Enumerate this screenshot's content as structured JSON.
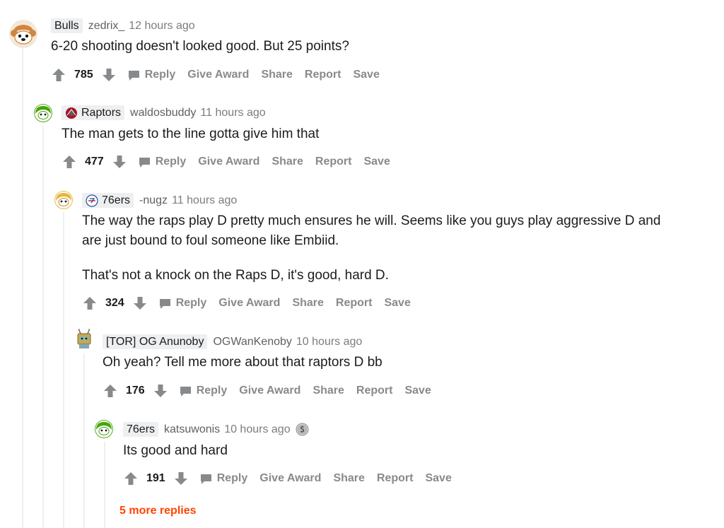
{
  "colors": {
    "accent_orange": "#ff4500",
    "muted_text": "#878a8c",
    "flair_bg": "#edeff1",
    "thread_line": "#edeff1"
  },
  "comments": [
    {
      "flair": "Bulls",
      "flair_icon": "",
      "username": "zedrix_",
      "timestamp": "12 hours ago",
      "body": [
        "6-20 shooting doesn't looked good. But 25 points?"
      ],
      "score": "785",
      "avatar_icon": "snoo-orange-avatar-icon"
    },
    {
      "flair": "Raptors",
      "flair_icon": "raptors-logo-icon",
      "username": "waldosbuddy",
      "timestamp": "11 hours ago",
      "body": [
        "The man gets to the line gotta give him that"
      ],
      "score": "477",
      "avatar_icon": "snoo-green-avatar-icon"
    },
    {
      "flair": "76ers",
      "flair_icon": "76ers-logo-icon",
      "username": "-nugz",
      "timestamp": "11 hours ago",
      "body": [
        "The way the raps play D pretty much ensures he will. Seems like you guys play aggressive D and are just bound to foul someone like Embiid.",
        "That's not a knock on the Raps D, it's good, hard D."
      ],
      "score": "324",
      "avatar_icon": "snoo-yellow-avatar-icon"
    },
    {
      "flair": "[TOR] OG Anunoby",
      "flair_icon": "",
      "username": "OGWanKenoby",
      "timestamp": "10 hours ago",
      "body": [
        "Oh yeah? Tell me more about that raptors D bb"
      ],
      "score": "176",
      "avatar_icon": "snoo-robot-avatar-icon"
    },
    {
      "flair": "76ers",
      "flair_icon": "",
      "username": "katsuwonis",
      "timestamp": "10 hours ago",
      "award_icon": "silver-award-icon",
      "body": [
        "Its good and hard"
      ],
      "score": "191",
      "avatar_icon": "snoo-green-avatar-icon"
    }
  ],
  "actions": {
    "reply": "Reply",
    "give_award": "Give Award",
    "share": "Share",
    "report": "Report",
    "save": "Save"
  },
  "more_replies": "5 more replies"
}
